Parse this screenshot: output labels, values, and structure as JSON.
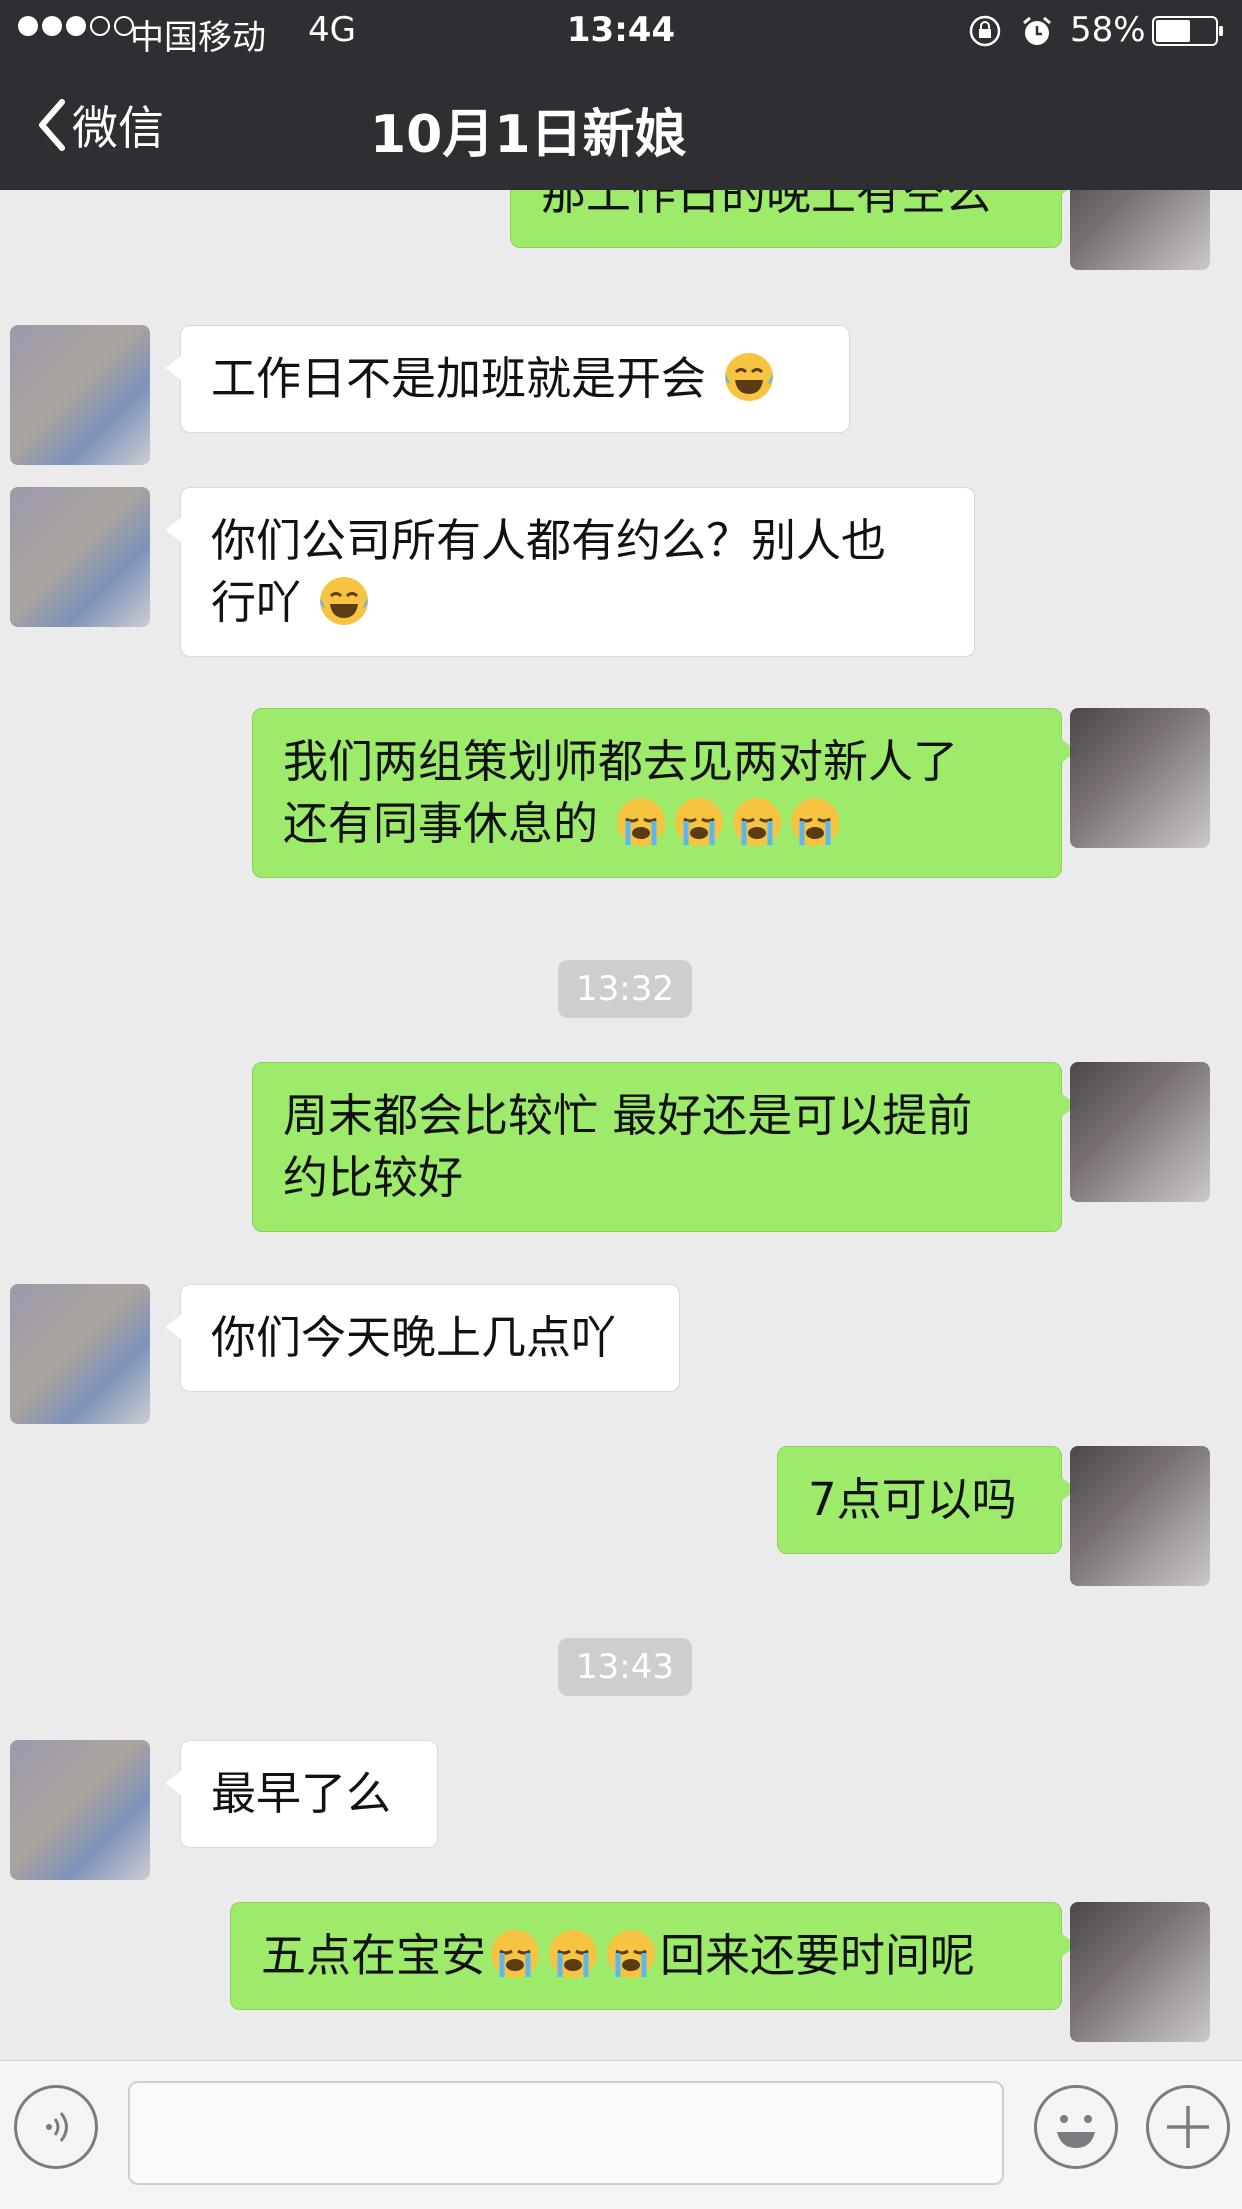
{
  "status_bar": {
    "carrier": "中国移动",
    "network": "4G",
    "time": "13:44",
    "battery_percent": "58%",
    "battery_level": 0.58,
    "signal_bars_filled": 3,
    "signal_bars_total": 5
  },
  "nav": {
    "back_label": "微信",
    "title": "10月1日新娘"
  },
  "messages": {
    "m1": {
      "text": "那工作日的晚上有空么",
      "side": "out"
    },
    "m2": {
      "text": "工作日不是加班就是开会",
      "side": "in",
      "emoji": [
        "laughing-tears"
      ]
    },
    "m3": {
      "line1": "你们公司所有人都有约么？别人也",
      "line2": "行吖",
      "side": "in",
      "emoji": [
        "laughing-tears"
      ]
    },
    "m4": {
      "line1": "我们两组策划师都去见两对新人了",
      "line2": "还有同事休息的",
      "side": "out",
      "emoji": [
        "loudly-crying",
        "loudly-crying",
        "loudly-crying",
        "loudly-crying"
      ]
    },
    "t1": "13:32",
    "m5": {
      "line1": "周末都会比较忙 最好还是可以提前",
      "line2": "约比较好",
      "side": "out"
    },
    "m6": {
      "text": "你们今天晚上几点吖",
      "side": "in"
    },
    "m7": {
      "text": "7点可以吗",
      "side": "out"
    },
    "t2": "13:43",
    "m8": {
      "text": "最早了么",
      "side": "in"
    },
    "m9": {
      "text_before": "五点在宝安",
      "text_after": "回来还要时间呢",
      "side": "out",
      "emoji": [
        "loudly-crying",
        "loudly-crying",
        "loudly-crying"
      ]
    }
  },
  "input_bar": {
    "placeholder": "",
    "icons": [
      "voice-icon",
      "emoji-face-icon",
      "plus-icon"
    ]
  },
  "colors": {
    "nav_bg": "#2e2e33",
    "chat_bg": "#ebebeb",
    "outgoing_bubble": "#9eea6a",
    "incoming_bubble": "#ffffff",
    "timestamp_bg": "#cecece"
  }
}
